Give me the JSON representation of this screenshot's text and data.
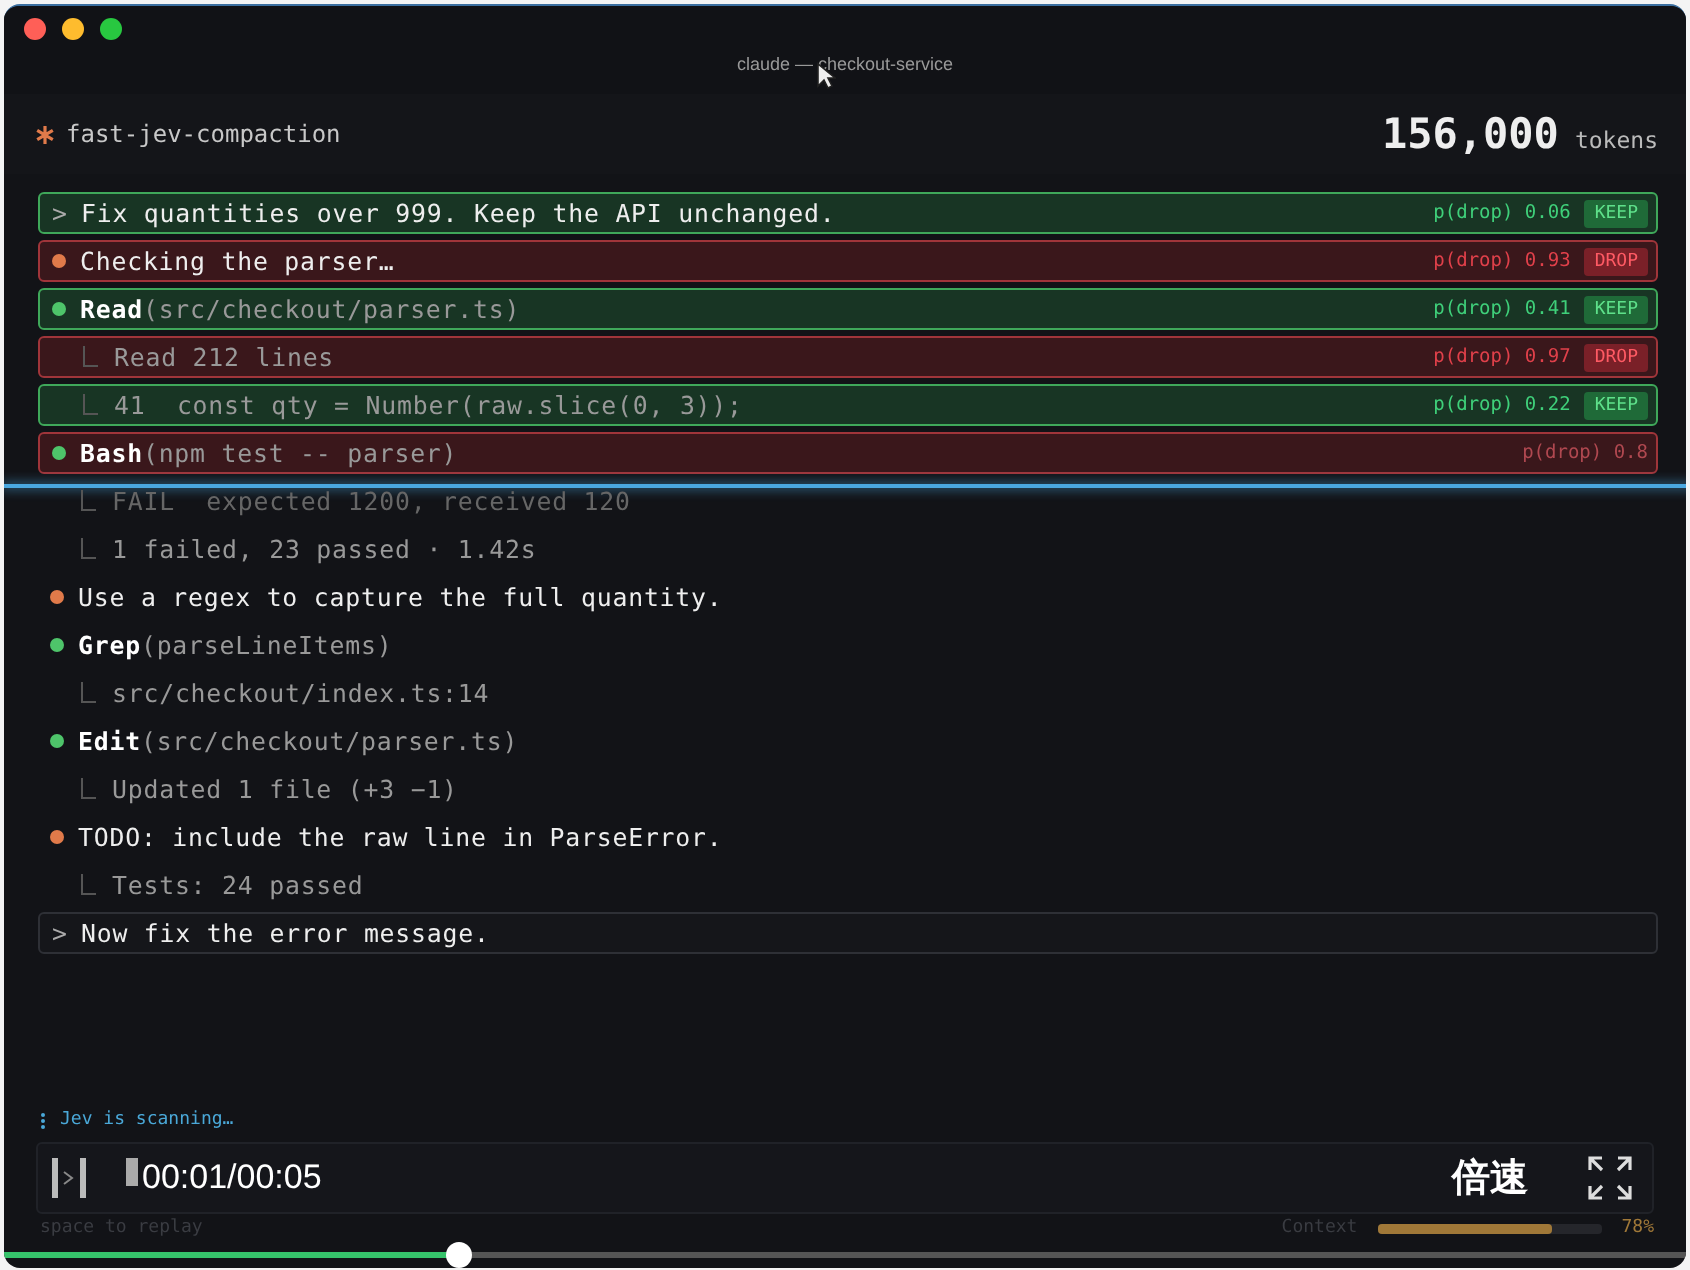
{
  "window": {
    "title": "claude — checkout-service"
  },
  "session": {
    "name": "fast-jev-compaction",
    "tokens": "156,000",
    "tokens_unit": "tokens"
  },
  "rows": [
    {
      "kind": "prompt",
      "marker": ">",
      "text": "Fix quantities over 999. Keep the API unchanged.",
      "kept": true,
      "score": "p(drop) 0.06",
      "badge": "KEEP"
    },
    {
      "kind": "message",
      "color": "#e07a4a",
      "text": "Checking the parser…",
      "kept": false,
      "score": "p(drop) 0.93",
      "badge": "DROP"
    },
    {
      "kind": "tool",
      "color": "#4ec46a",
      "tool": "Read",
      "args": "(src/checkout/parser.ts)",
      "kept": true,
      "score": "p(drop) 0.41",
      "badge": "KEEP"
    },
    {
      "kind": "result",
      "text": "Read 212 lines",
      "kept": false,
      "score": "p(drop) 0.97",
      "badge": "DROP"
    },
    {
      "kind": "result",
      "text": "41  const qty = Number(raw.slice(0, 3));",
      "kept": true,
      "score": "p(drop) 0.22",
      "badge": "KEEP"
    },
    {
      "kind": "tool",
      "color": "#4ec46a",
      "tool": "Bash",
      "args": "(npm test -- parser)",
      "kept": false,
      "scanning": true,
      "score": "p(drop) 0.8"
    },
    {
      "kind": "result",
      "text": "FAIL  expected 1200, received 120",
      "dim": true
    },
    {
      "kind": "result",
      "text": "1 failed, 23 passed · 1.42s"
    },
    {
      "kind": "message",
      "color": "#e07a4a",
      "text": "Use a regex to capture the full quantity."
    },
    {
      "kind": "tool",
      "color": "#4ec46a",
      "tool": "Grep",
      "args": "(parseLineItems)"
    },
    {
      "kind": "result",
      "text": "src/checkout/index.ts:14"
    },
    {
      "kind": "tool",
      "color": "#4ec46a",
      "tool": "Edit",
      "args": "(src/checkout/parser.ts)"
    },
    {
      "kind": "result",
      "text": "Updated 1 file (+3 −1)"
    },
    {
      "kind": "message",
      "color": "#e07a4a",
      "text": "TODO: include the raw line in ParseError."
    },
    {
      "kind": "result",
      "text": "Tests: 24 passed"
    },
    {
      "kind": "prompt",
      "marker": ">",
      "text": "Now fix the error message."
    }
  ],
  "status": {
    "text": "Jev is scanning…"
  },
  "player": {
    "time": "00:01/00:05",
    "speed": "倍速",
    "level": 0.27
  },
  "footer": {
    "hint": "space to replay",
    "context_label": "Context",
    "context": {
      "level": 0.78
    },
    "context_reading": "78%"
  }
}
